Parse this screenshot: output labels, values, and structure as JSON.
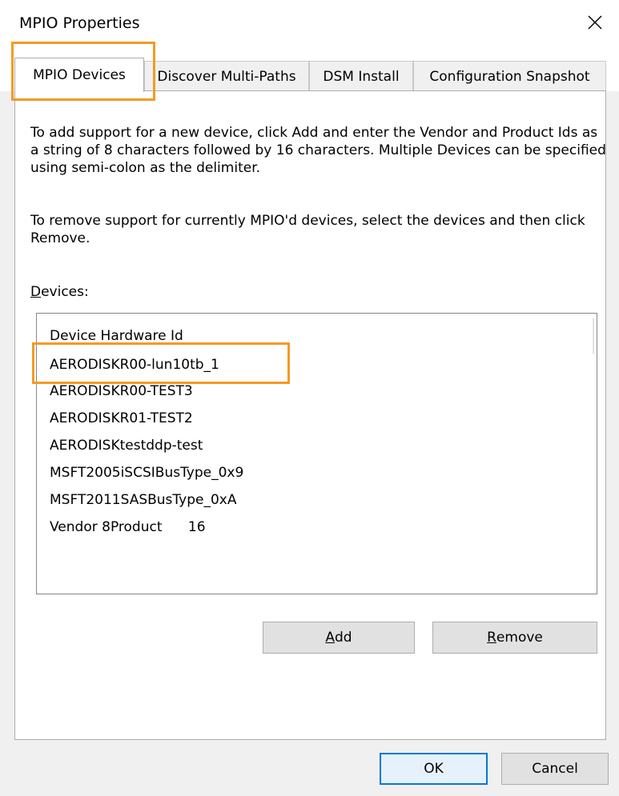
{
  "window": {
    "title": "MPIO Properties"
  },
  "tabs": [
    {
      "label": "MPIO Devices",
      "active": true
    },
    {
      "label": "Discover Multi-Paths",
      "active": false
    },
    {
      "label": "DSM Install",
      "active": false
    },
    {
      "label": "Configuration Snapshot",
      "active": false
    }
  ],
  "panel": {
    "description_add": "To add support for a new device, click Add and enter the Vendor and Product Ids as a string of 8 characters followed by 16 characters. Multiple Devices can be specified using semi-colon as the delimiter.",
    "description_remove": "To remove support for currently MPIO'd devices, select the devices and then click Remove.",
    "devices_label_first": "D",
    "devices_label_rest": "evices:",
    "list": {
      "header": "Device Hardware Id",
      "items": [
        "AERODISKR00-lun10tb_1",
        "AERODISKR00-TEST3",
        "AERODISKR01-TEST2",
        "AERODISKtestddp-test",
        "MSFT2005iSCSIBusType_0x9",
        "MSFT2011SASBusType_0xA",
        "Vendor 8Product      16"
      ]
    },
    "add_button": {
      "accel": "A",
      "rest": "dd"
    },
    "remove_button": {
      "accel": "R",
      "rest": "emove"
    }
  },
  "footer": {
    "ok_label": "OK",
    "cancel_label": "Cancel"
  },
  "icons": {
    "close": "close-icon"
  },
  "colors": {
    "highlight": "#f59a23",
    "default_button_border": "#0078d7"
  }
}
